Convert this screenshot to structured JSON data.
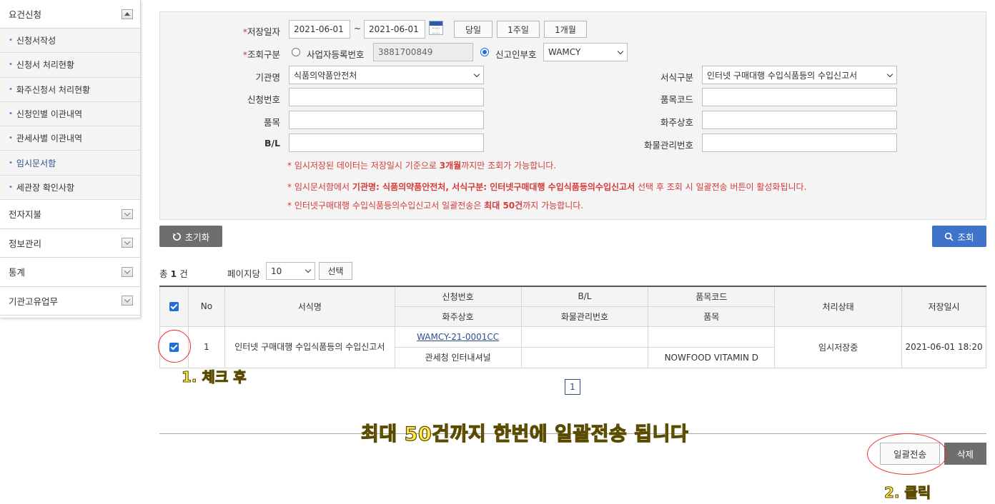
{
  "sidebar": {
    "section_title": "요건신청",
    "items": [
      {
        "label": "신청서작성"
      },
      {
        "label": "신청서 처리현황"
      },
      {
        "label": "화주신청서 처리현황"
      },
      {
        "label": "신청인별 이관내역"
      },
      {
        "label": "관세사별 이관내역"
      },
      {
        "label": "임시문서함"
      },
      {
        "label": "세관장 확인사항"
      }
    ],
    "groups": [
      {
        "label": "전자지불"
      },
      {
        "label": "정보관리"
      },
      {
        "label": "통계"
      },
      {
        "label": "기관고유업무"
      }
    ]
  },
  "search": {
    "save_date_label": "저장일자",
    "required_mark": "*",
    "date_from": "2021-06-01",
    "date_sep": "~",
    "date_to": "2021-06-01",
    "btn_today": "당일",
    "btn_week": "1주일",
    "btn_month": "1개월",
    "query_type_label": "조회구분",
    "radio_bizno_label": "사업자등록번호",
    "bizno_value": "3881700849",
    "radio_declarant_label": "신고인부호",
    "declarant_value": "WAMCY",
    "agency_label": "기관명",
    "agency_value": "식품의약품안전처",
    "form_type_label": "서식구분",
    "form_type_value": "인터넷 구매대행 수입식품등의 수입신고서",
    "app_no_label": "신청번호",
    "item_code_label": "품목코드",
    "item_label": "품목",
    "owner_label": "화주상호",
    "bl_label": "B/L",
    "cargo_no_label": "화물관리번호",
    "notes": {
      "n1_a": "* 임시저장된 데이터는 저장일시 기준으로 ",
      "n1_b": "3개월",
      "n1_c": "까지만 조회가 가능합니다.",
      "n2_a": "* 임시문서함에서 ",
      "n2_b": "기관명: 식품의약품안전처, 서식구분: 인터넷구매대행 수입식품등의수입신고서",
      "n2_c": " 선택 후 조회 시 일괄전송 버튼이 활성화됩니다.",
      "n3_a": "* 인터넷구매대행 수입식품등의수입신고서 일괄전송은 ",
      "n3_b": "최대 50건",
      "n3_c": "까지 가능합니다."
    },
    "btn_reset": "초기화",
    "btn_search": "조회"
  },
  "list": {
    "total_prefix": "총",
    "total_count": "1",
    "total_suffix": "건",
    "per_page_label": "페이지당",
    "per_page_value": "10",
    "btn_select": "선택",
    "headers": {
      "no": "No",
      "form_name": "서식명",
      "app_no": "신청번호",
      "owner": "화주상호",
      "bl": "B/L",
      "cargo_no": "화물관리번호",
      "item_code": "품목코드",
      "item": "품목",
      "status": "처리상태",
      "saved_at": "저장일시"
    },
    "rows": [
      {
        "no": "1",
        "form_name": "인터넷 구매대행 수입식품등의 수입신고서",
        "app_no": "WAMCY-21-0001CC",
        "owner": "관세청 인터내셔널",
        "bl": "",
        "cargo_no": "",
        "item_code": "",
        "item": "NOWFOOD VITAMIN D",
        "status": "임시저장중",
        "saved_at": "2021-06-01 18:20"
      }
    ],
    "page": "1"
  },
  "actions": {
    "btn_bulk_send": "일괄전송",
    "btn_delete": "삭제"
  },
  "annotations": {
    "step1": "1. 체크 후",
    "step2": "2. 클릭",
    "banner": "최대 50건까지 한번에 일괄전송 됩니다",
    "highlight_color": "#ffe94d",
    "circle_color": "#e33333"
  }
}
